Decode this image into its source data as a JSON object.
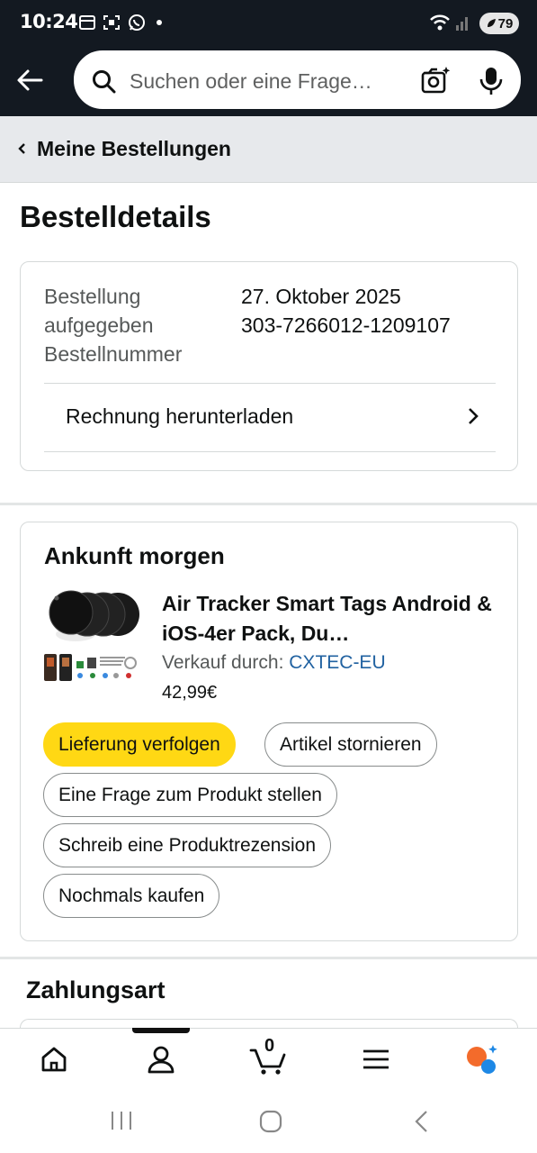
{
  "status_bar": {
    "time": "10:24",
    "battery": "79"
  },
  "header": {
    "search_placeholder": "Suchen oder eine Frage…"
  },
  "breadcrumb": {
    "label": "Meine Bestellungen"
  },
  "page_title": "Bestelldetails",
  "order_info": {
    "date_label": "Bestellung aufgegeben",
    "date_value": "27. Oktober 2025",
    "number_label": "Bestellnummer",
    "number_value": "303-7266012-1209107",
    "invoice_link": "Rechnung herunterladen"
  },
  "shipment": {
    "heading": "Ankunft morgen",
    "product_title": "Air Tracker Smart Tags Android & iOS-4er Pack, Du…",
    "seller_label": "Verkauf durch:",
    "seller_name": "CXTEC-EU",
    "price": "42,99€",
    "buttons": {
      "track": "Lieferung verfolgen",
      "cancel": "Artikel stornieren",
      "question": "Eine Frage zum Produkt stellen",
      "review": "Schreib eine Produktrezension",
      "rebuy": "Nochmals kaufen"
    }
  },
  "payment": {
    "heading": "Zahlungsart"
  },
  "bottom_nav": {
    "cart_count": "0",
    "items": [
      "home-icon",
      "account-icon",
      "cart-icon",
      "menu-icon",
      "rufus-icon"
    ]
  },
  "colors": {
    "header_bg": "#131921",
    "primary_button": "#ffd814",
    "link": "#2162a1"
  }
}
